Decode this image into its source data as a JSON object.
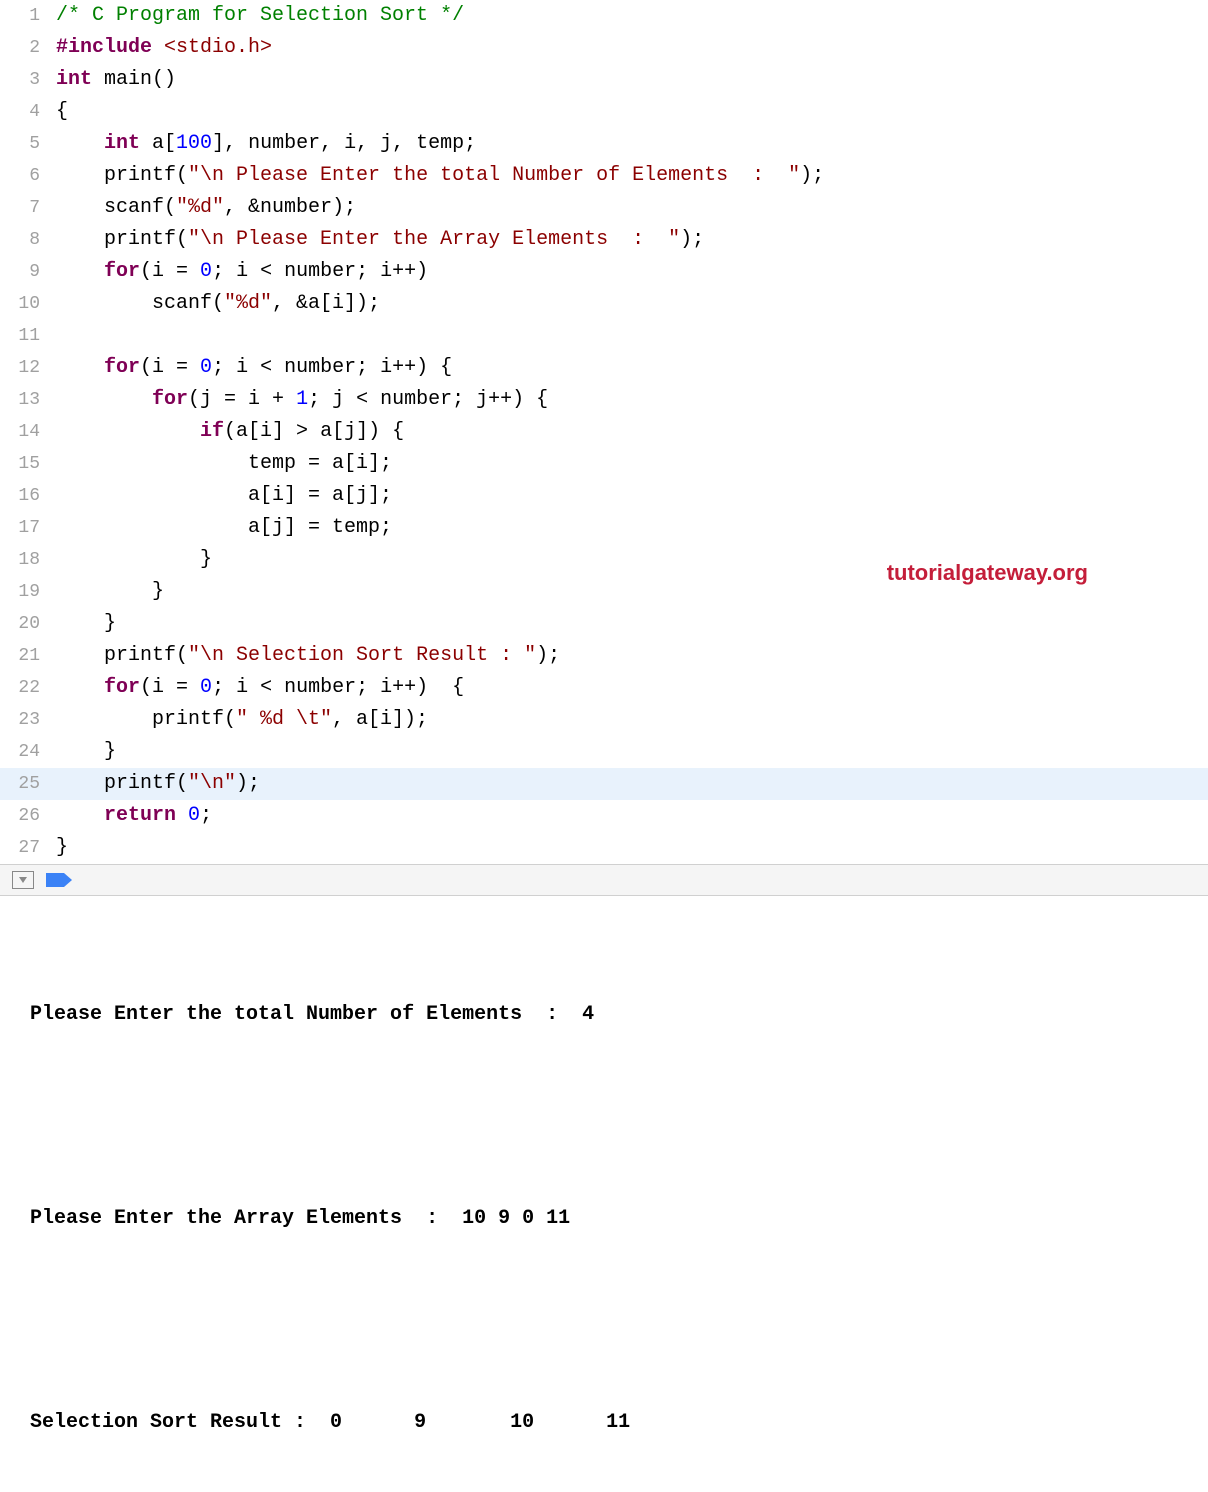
{
  "watermark": "tutorialgateway.org",
  "highlighted_line": 25,
  "lines": [
    {
      "num": "1",
      "tokens": [
        [
          "comment",
          "/* C Program for Selection Sort */"
        ]
      ]
    },
    {
      "num": "2",
      "tokens": [
        [
          "preprocessor",
          "#include "
        ],
        [
          "include-path",
          "<stdio.h>"
        ]
      ]
    },
    {
      "num": "3",
      "tokens": [
        [
          "type",
          "int"
        ],
        [
          "identifier",
          " main()"
        ]
      ]
    },
    {
      "num": "4",
      "tokens": [
        [
          "punctuation",
          "{"
        ]
      ]
    },
    {
      "num": "5",
      "tokens": [
        [
          "identifier",
          "    "
        ],
        [
          "type",
          "int"
        ],
        [
          "identifier",
          " a["
        ],
        [
          "number",
          "100"
        ],
        [
          "identifier",
          "], number, i, j, temp;"
        ]
      ]
    },
    {
      "num": "6",
      "tokens": [
        [
          "identifier",
          "    printf("
        ],
        [
          "string",
          "\"\\n Please Enter the total Number of Elements  :  \""
        ],
        [
          "identifier",
          ");"
        ]
      ]
    },
    {
      "num": "7",
      "tokens": [
        [
          "identifier",
          "    scanf("
        ],
        [
          "string",
          "\"%d\""
        ],
        [
          "identifier",
          ", &number);"
        ]
      ]
    },
    {
      "num": "8",
      "tokens": [
        [
          "identifier",
          "    printf("
        ],
        [
          "string",
          "\"\\n Please Enter the Array Elements  :  \""
        ],
        [
          "identifier",
          ");"
        ]
      ]
    },
    {
      "num": "9",
      "tokens": [
        [
          "identifier",
          "    "
        ],
        [
          "keyword",
          "for"
        ],
        [
          "identifier",
          "(i = "
        ],
        [
          "number",
          "0"
        ],
        [
          "identifier",
          "; i < number; i++)"
        ]
      ]
    },
    {
      "num": "10",
      "tokens": [
        [
          "identifier",
          "        scanf("
        ],
        [
          "string",
          "\"%d\""
        ],
        [
          "identifier",
          ", &a[i]);"
        ]
      ]
    },
    {
      "num": "11",
      "tokens": []
    },
    {
      "num": "12",
      "tokens": [
        [
          "identifier",
          "    "
        ],
        [
          "keyword",
          "for"
        ],
        [
          "identifier",
          "(i = "
        ],
        [
          "number",
          "0"
        ],
        [
          "identifier",
          "; i < number; i++) {"
        ]
      ]
    },
    {
      "num": "13",
      "tokens": [
        [
          "identifier",
          "        "
        ],
        [
          "keyword",
          "for"
        ],
        [
          "identifier",
          "(j = i + "
        ],
        [
          "number",
          "1"
        ],
        [
          "identifier",
          "; j < number; j++) {"
        ]
      ]
    },
    {
      "num": "14",
      "tokens": [
        [
          "identifier",
          "            "
        ],
        [
          "keyword",
          "if"
        ],
        [
          "identifier",
          "(a[i] > a[j]) {"
        ]
      ]
    },
    {
      "num": "15",
      "tokens": [
        [
          "identifier",
          "                temp = a[i];"
        ]
      ]
    },
    {
      "num": "16",
      "tokens": [
        [
          "identifier",
          "                a[i] = a[j];"
        ]
      ]
    },
    {
      "num": "17",
      "tokens": [
        [
          "identifier",
          "                a[j] = temp;"
        ]
      ]
    },
    {
      "num": "18",
      "tokens": [
        [
          "identifier",
          "            }"
        ]
      ]
    },
    {
      "num": "19",
      "tokens": [
        [
          "identifier",
          "        }"
        ]
      ]
    },
    {
      "num": "20",
      "tokens": [
        [
          "identifier",
          "    }"
        ]
      ]
    },
    {
      "num": "21",
      "tokens": [
        [
          "identifier",
          "    printf("
        ],
        [
          "string",
          "\"\\n Selection Sort Result : \""
        ],
        [
          "identifier",
          ");"
        ]
      ]
    },
    {
      "num": "22",
      "tokens": [
        [
          "identifier",
          "    "
        ],
        [
          "keyword",
          "for"
        ],
        [
          "identifier",
          "(i = "
        ],
        [
          "number",
          "0"
        ],
        [
          "identifier",
          "; i < number; i++)  {"
        ]
      ]
    },
    {
      "num": "23",
      "tokens": [
        [
          "identifier",
          "        printf("
        ],
        [
          "string",
          "\" %d \\t\""
        ],
        [
          "identifier",
          ", a[i]);"
        ]
      ]
    },
    {
      "num": "24",
      "tokens": [
        [
          "identifier",
          "    }"
        ]
      ]
    },
    {
      "num": "25",
      "tokens": [
        [
          "identifier",
          "    printf("
        ],
        [
          "string",
          "\"\\n\""
        ],
        [
          "identifier",
          ");"
        ]
      ]
    },
    {
      "num": "26",
      "tokens": [
        [
          "identifier",
          "    "
        ],
        [
          "keyword",
          "return"
        ],
        [
          "identifier",
          " "
        ],
        [
          "number",
          "0"
        ],
        [
          "identifier",
          ";"
        ]
      ]
    },
    {
      "num": "27",
      "tokens": [
        [
          "punctuation",
          "}"
        ]
      ]
    }
  ],
  "console": {
    "line1": " Please Enter the total Number of Elements  :  4",
    "line2": " Please Enter the Array Elements  :  10 9 0 11",
    "line3": " Selection Sort Result :  0 \t 9 \t 10 \t 11"
  }
}
